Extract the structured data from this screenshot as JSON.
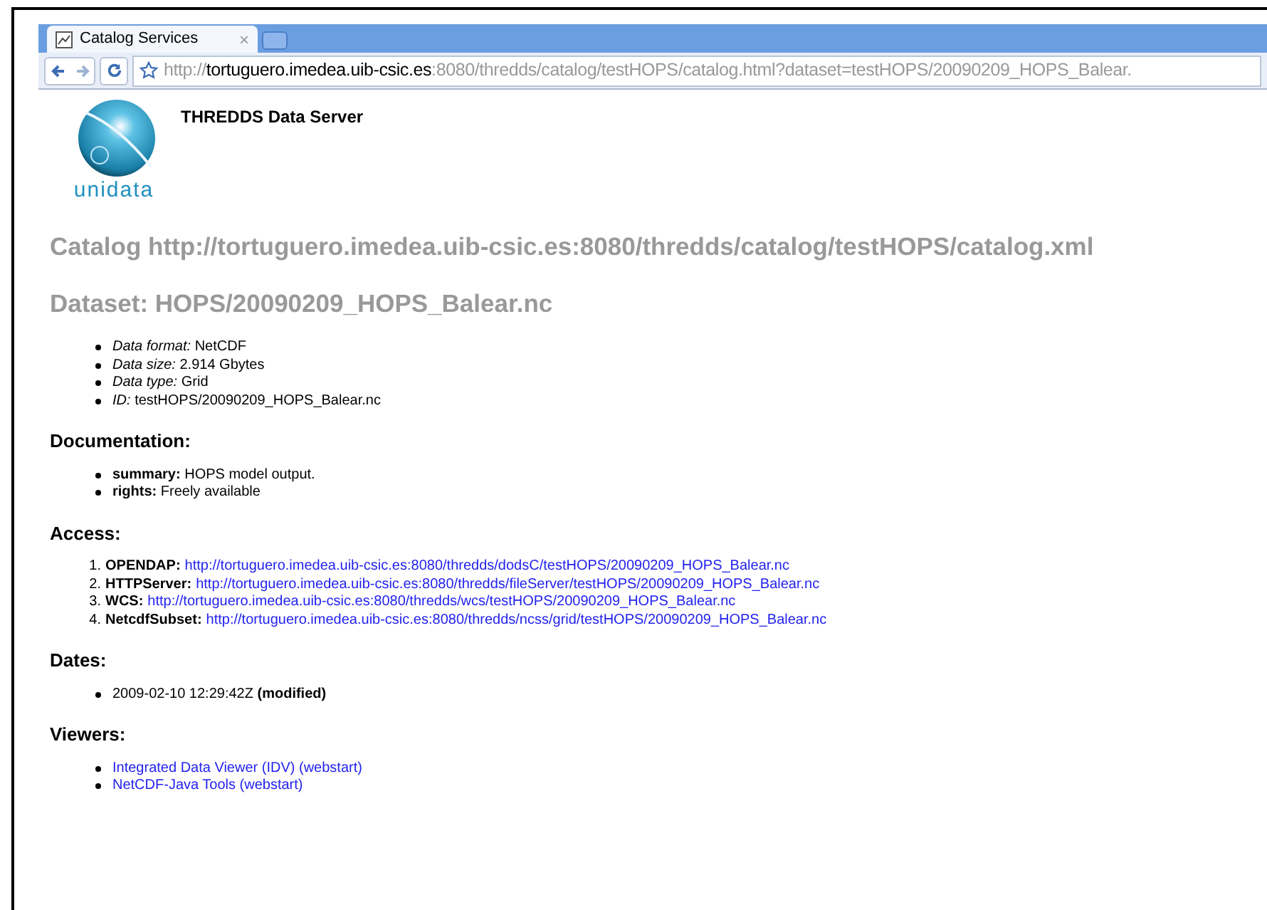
{
  "browser": {
    "tab": {
      "title": "Catalog Services",
      "close": "×"
    },
    "address": {
      "scheme": "http://",
      "host": "tortuguero.imedea.uib-csic.es",
      "path": ":8080/thredds/catalog/testHOPS/catalog.html?dataset=testHOPS/20090209_HOPS_Balear."
    }
  },
  "header": {
    "title": "THREDDS Data Server",
    "logo_text": "unidata"
  },
  "catalog_heading": "Catalog http://tortuguero.imedea.uib-csic.es:8080/thredds/catalog/testHOPS/catalog.xml",
  "dataset_heading": "Dataset: HOPS/20090209_HOPS_Balear.nc",
  "properties": [
    {
      "label": "Data format:",
      "value": "NetCDF"
    },
    {
      "label": "Data size:",
      "value": "2.914 Gbytes"
    },
    {
      "label": "Data type:",
      "value": "Grid"
    },
    {
      "label": "ID:",
      "value": "testHOPS/20090209_HOPS_Balear.nc"
    }
  ],
  "documentation": {
    "heading": "Documentation:",
    "items": [
      {
        "label": "summary:",
        "value": "HOPS model output."
      },
      {
        "label": "rights:",
        "value": "Freely available"
      }
    ]
  },
  "access": {
    "heading": "Access:",
    "items": [
      {
        "number": "1.",
        "label": "OPENDAP:",
        "url": "http://tortuguero.imedea.uib-csic.es:8080/thredds/dodsC/testHOPS/20090209_HOPS_Balear.nc"
      },
      {
        "number": "2.",
        "label": "HTTPServer:",
        "url": "http://tortuguero.imedea.uib-csic.es:8080/thredds/fileServer/testHOPS/20090209_HOPS_Balear.nc"
      },
      {
        "number": "3.",
        "label": "WCS:",
        "url": "http://tortuguero.imedea.uib-csic.es:8080/thredds/wcs/testHOPS/20090209_HOPS_Balear.nc"
      },
      {
        "number": "4.",
        "label": "NetcdfSubset:",
        "url": "http://tortuguero.imedea.uib-csic.es:8080/thredds/ncss/grid/testHOPS/20090209_HOPS_Balear.nc"
      }
    ]
  },
  "dates": {
    "heading": "Dates:",
    "items": [
      {
        "date": "2009-02-10 12:29:42Z",
        "type": "(modified)"
      }
    ]
  },
  "viewers": {
    "heading": "Viewers:",
    "items": [
      "Integrated Data Viewer (IDV) (webstart)",
      "NetCDF-Java Tools (webstart)"
    ]
  }
}
